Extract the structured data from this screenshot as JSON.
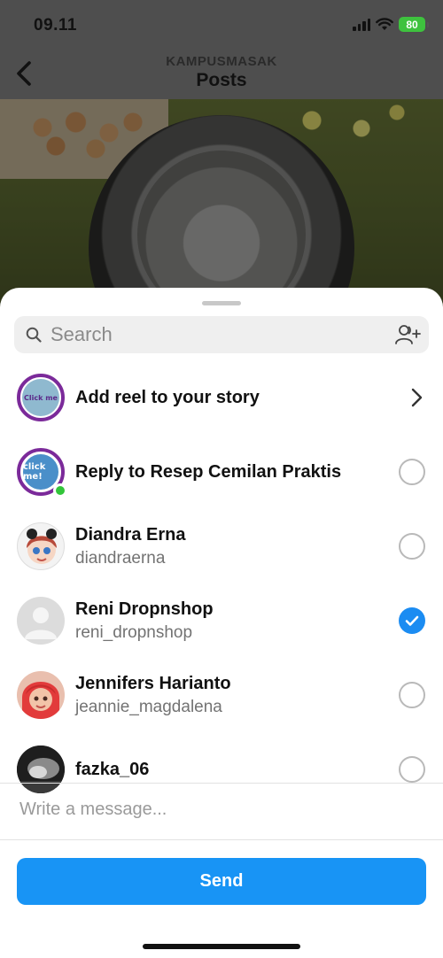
{
  "status_bar": {
    "time": "09.11",
    "battery": "80"
  },
  "nav": {
    "account": "KAMPUSMASAK",
    "title": "Posts"
  },
  "search": {
    "placeholder": "Search"
  },
  "rows": [
    {
      "title": "Add reel to your story",
      "subtitle": ""
    },
    {
      "title": "Reply to Resep Cemilan Praktis",
      "subtitle": "",
      "selected": false
    },
    {
      "title": "Diandra Erna",
      "subtitle": "diandraerna",
      "selected": false
    },
    {
      "title": "Reni Dropnshop",
      "subtitle": "reni_dropnshop",
      "selected": true
    },
    {
      "title": "Jennifers Harianto",
      "subtitle": "jeannie_magdalena",
      "selected": false
    },
    {
      "title": "fazka_06",
      "subtitle": "",
      "selected": false
    }
  ],
  "avatars": {
    "story": "Click me",
    "reply": "click me!"
  },
  "message": {
    "placeholder": "Write a message..."
  },
  "send": {
    "label": "Send"
  },
  "colors": {
    "accent": "#1894f5",
    "online": "#32c53a",
    "story_ring": "#7b2a9a"
  }
}
